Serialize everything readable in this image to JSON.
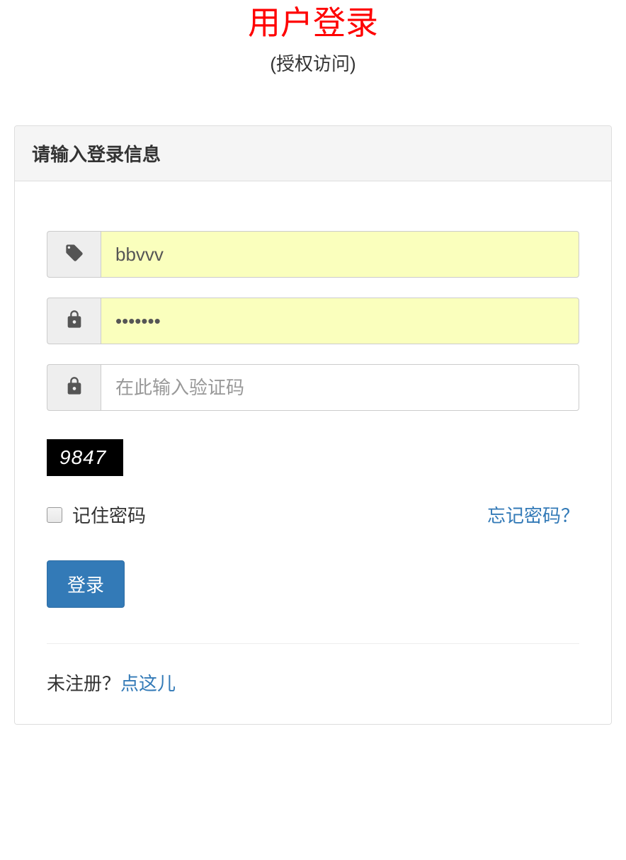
{
  "header": {
    "title": "用户登录",
    "subtitle": "(授权访问)"
  },
  "panel": {
    "heading": "请输入登录信息"
  },
  "form": {
    "username_value": "bbvvv",
    "password_value": "•••••••",
    "captcha_placeholder": "在此输入验证码",
    "captcha_image_text": "9847",
    "remember_label": "记住密码",
    "forgot_label": "忘记密码？",
    "submit_label": "登录",
    "register_prefix": "未注册？",
    "register_link": "点这儿"
  }
}
